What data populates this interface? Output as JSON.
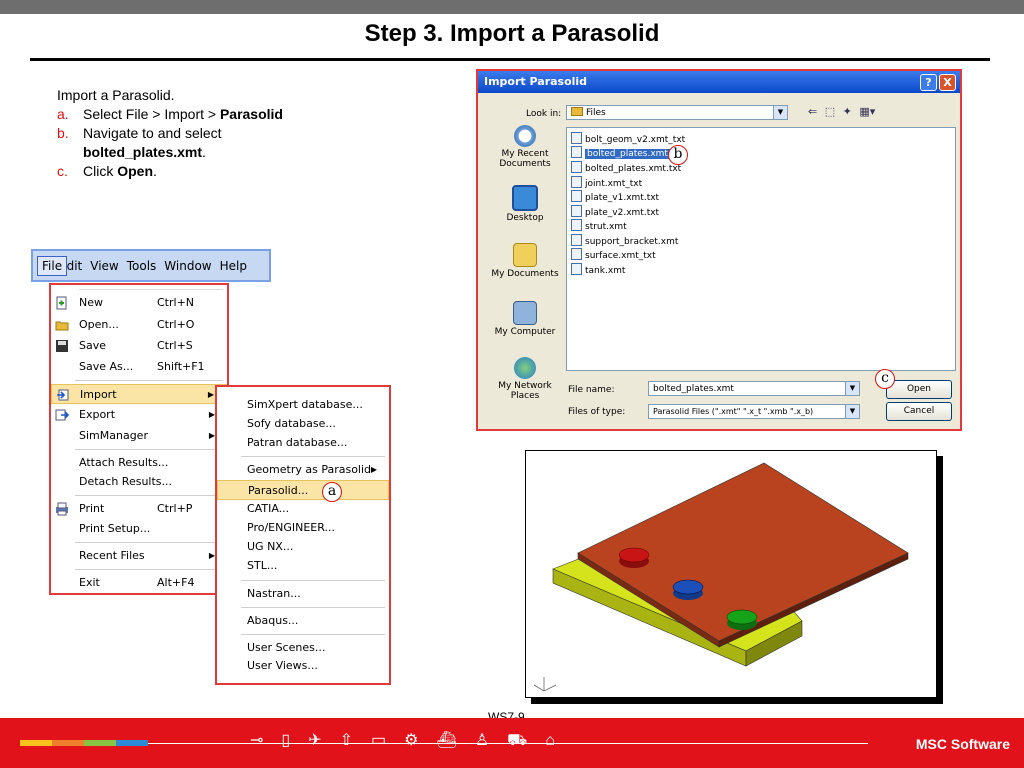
{
  "slide": {
    "title": "Step 3. Import a Parasolid",
    "instructions": {
      "intro": "Import a Parasolid.",
      "steps": [
        {
          "letter": "a.",
          "text": "Select File > Import > ",
          "bold": "Parasolid",
          "after": ""
        },
        {
          "letter": "b.",
          "text": "Navigate to and select",
          "bold": "bolted_plates.xmt",
          "after": "."
        },
        {
          "letter": "c.",
          "text": "Click ",
          "bold": "Open",
          "after": "."
        }
      ]
    },
    "page_label": "WS7-9",
    "brand": "MSC Software"
  },
  "menubar": {
    "items": [
      "File",
      "Edit",
      "View",
      "Tools",
      "Window",
      "Help"
    ]
  },
  "file_menu": {
    "items": [
      {
        "label": "New",
        "shortcut": "Ctrl+N",
        "icon": "new-icon"
      },
      {
        "label": "Open...",
        "shortcut": "Ctrl+O",
        "icon": "open-folder-icon"
      },
      {
        "label": "Save",
        "shortcut": "Ctrl+S",
        "icon": "save-icon"
      },
      {
        "label": "Save As...",
        "shortcut": "Shift+F1",
        "icon": ""
      },
      {
        "label": "Import",
        "shortcut": "",
        "icon": "import-icon"
      },
      {
        "label": "Export",
        "shortcut": "",
        "icon": "export-icon"
      },
      {
        "label": "SimManager",
        "shortcut": "",
        "icon": ""
      },
      {
        "label": "Attach Results...",
        "shortcut": "",
        "icon": ""
      },
      {
        "label": "Detach Results...",
        "shortcut": "",
        "icon": ""
      },
      {
        "label": "Print",
        "shortcut": "Ctrl+P",
        "icon": "print-icon"
      },
      {
        "label": "Print Setup...",
        "shortcut": "",
        "icon": ""
      },
      {
        "label": "Recent Files",
        "shortcut": "",
        "icon": ""
      },
      {
        "label": "Exit",
        "shortcut": "Alt+F4",
        "icon": ""
      }
    ]
  },
  "import_menu": {
    "items": [
      "SimXpert database...",
      "Sofy database...",
      "Patran database...",
      "Geometry as Parasolid",
      "Parasolid...",
      "CATIA...",
      "Pro/ENGINEER...",
      "UG NX...",
      "STL...",
      "Nastran...",
      "Abaqus...",
      "User Scenes...",
      "User Views..."
    ]
  },
  "callouts": {
    "a": "a",
    "b": "b",
    "c": "c"
  },
  "dialog": {
    "title": "Import Parasolid",
    "help_btn": "?",
    "close_btn": "X",
    "look_in_label": "Look in:",
    "look_in_value": "Files",
    "places": [
      "My Recent Documents",
      "Desktop",
      "My Documents",
      "My Computer",
      "My Network Places"
    ],
    "files": [
      "bolt_geom_v2.xmt_txt",
      "bolted_plates.xmt",
      "bolted_plates.xmt.txt",
      "joint.xmt_txt",
      "plate_v1.xmt.txt",
      "plate_v2.xmt.txt",
      "strut.xmt",
      "support_bracket.xmt",
      "surface.xmt_txt",
      "tank.xmt"
    ],
    "selected_file": "bolted_plates.xmt",
    "file_name_label": "File name:",
    "file_name_value": "bolted_plates.xmt",
    "file_type_label": "Files of type:",
    "file_type_value": "Parasolid Files (\".xmt\" \".x_t \".xmb \".x_b)",
    "open_button": "Open",
    "cancel_button": "Cancel"
  },
  "colors": {
    "accent_red": "#e1121a",
    "menu_highlight": "#fbe5a6",
    "plate_top": "#b8431e",
    "plate_bottom": "#d4e31c",
    "bolt_red": "#c81414",
    "bolt_blue": "#1c4fb8",
    "bolt_green": "#15a31a"
  }
}
